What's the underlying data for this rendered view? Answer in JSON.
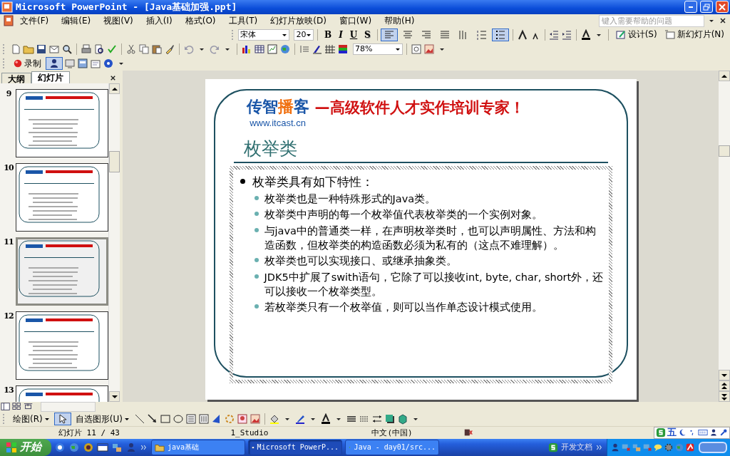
{
  "window": {
    "title": "Microsoft PowerPoint - [Java基础加强.ppt]"
  },
  "menu": [
    "文件(F)",
    "编辑(E)",
    "视图(V)",
    "插入(I)",
    "格式(O)",
    "工具(T)",
    "幻灯片放映(D)",
    "窗口(W)",
    "帮助(H)"
  ],
  "help_box": {
    "placeholder": "键入需要帮助的问题"
  },
  "formatting": {
    "font": "宋体",
    "size": "20",
    "style_buttons": [
      {
        "label": "B",
        "kind": "bold"
      },
      {
        "label": "I",
        "kind": "italic"
      },
      {
        "label": "U",
        "kind": "underline"
      },
      {
        "label": "S",
        "kind": "shadow"
      }
    ],
    "paragraph_buttons": [
      {
        "kind": "align-left",
        "selected": true
      },
      {
        "kind": "align-center",
        "selected": false
      },
      {
        "kind": "align-right",
        "selected": false
      },
      {
        "kind": "distribute",
        "selected": false
      },
      {
        "kind": "line-spacing",
        "selected": false
      },
      {
        "kind": "numbering",
        "selected": false
      },
      {
        "kind": "bullets",
        "selected": true
      }
    ],
    "design": "设计(S)",
    "new_slide": "新幻灯片(N)"
  },
  "standard": {
    "zoom": "78%"
  },
  "recording": {
    "label": "录制"
  },
  "panel": {
    "tabs": [
      {
        "label": "大纲",
        "selected": false
      },
      {
        "label": "幻灯片",
        "selected": true
      }
    ],
    "thumbnails": [
      {
        "number": "9",
        "selected": false
      },
      {
        "number": "10",
        "selected": false
      },
      {
        "number": "11",
        "selected": true
      },
      {
        "number": "12",
        "selected": false
      },
      {
        "number": "13",
        "selected": false
      }
    ]
  },
  "slide": {
    "logo": [
      {
        "text": "传智",
        "color": "#1a56a8"
      },
      {
        "text": "播",
        "color": "#f07010"
      },
      {
        "text": "客",
        "color": "#1a56a8"
      }
    ],
    "url": "www.itcast.cn",
    "slogan": "—高级软件人才实作培训专家！",
    "title": "枚举类",
    "bullets": [
      {
        "text": "枚举类具有如下特性：",
        "children": [
          {
            "text": "枚举类也是一种特殊形式的Java类。"
          },
          {
            "text": "枚举类中声明的每一个枚举值代表枚举类的一个实例对象。"
          },
          {
            "text": "与java中的普通类一样，在声明枚举类时，也可以声明属性、方法和构造函数，但枚举类的构造函数必须为私有的（这点不难理解）。"
          },
          {
            "text": "枚举类也可以实现接口、或继承抽象类。"
          },
          {
            "text": "JDK5中扩展了swith语句，它除了可以接收int, byte, char, short外，还可以接收一个枚举类型。"
          },
          {
            "text": "若枚举类只有一个枚举值，则可以当作单态设计模式使用。"
          }
        ]
      }
    ]
  },
  "drawing": {
    "draw": "绘图(R)",
    "autoshapes": "自选图形(U)"
  },
  "status": [
    "幻灯片 11 / 43",
    "1_Studio",
    "中文(中国)"
  ],
  "ime": {
    "label": "五"
  },
  "taskbar": {
    "start": "开始",
    "tasks": [
      {
        "label": "java基础",
        "kind": "folder",
        "selected": false
      },
      {
        "label": "Microsoft PowerP...",
        "kind": "powerpoint",
        "selected": true
      },
      {
        "label": "Java - day01/src...",
        "kind": "eclipse",
        "selected": false
      }
    ],
    "docs": "开发文档"
  }
}
